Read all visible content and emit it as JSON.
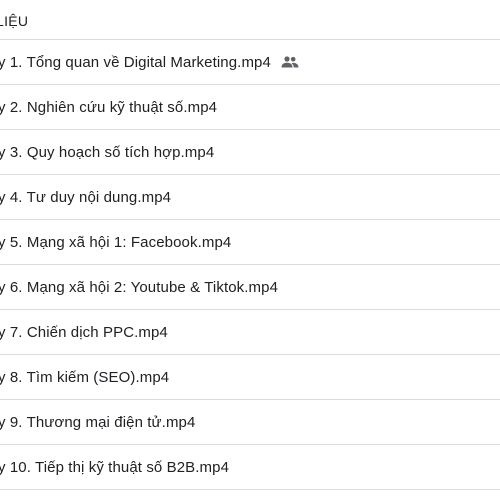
{
  "header": {
    "title": "LIỆU"
  },
  "files": [
    {
      "name": "y 1. Tổng quan về Digital Marketing.mp4",
      "shared_icon": "people-icon"
    },
    {
      "name": "y 2. Nghiên cứu kỹ thuật số.mp4"
    },
    {
      "name": "y 3. Quy hoạch số tích hợp.mp4"
    },
    {
      "name": "y 4. Tư duy nội dung.mp4"
    },
    {
      "name": "y 5. Mạng xã hội 1: Facebook.mp4"
    },
    {
      "name": "y 6. Mạng xã hội 2: Youtube & Tiktok.mp4"
    },
    {
      "name": "y 7. Chiến dịch PPC.mp4"
    },
    {
      "name": "y 8. Tìm kiếm (SEO).mp4"
    },
    {
      "name": "y 9. Thương mại điện tử.mp4"
    },
    {
      "name": "y 10. Tiếp thị kỹ thuật số B2B.mp4"
    }
  ]
}
